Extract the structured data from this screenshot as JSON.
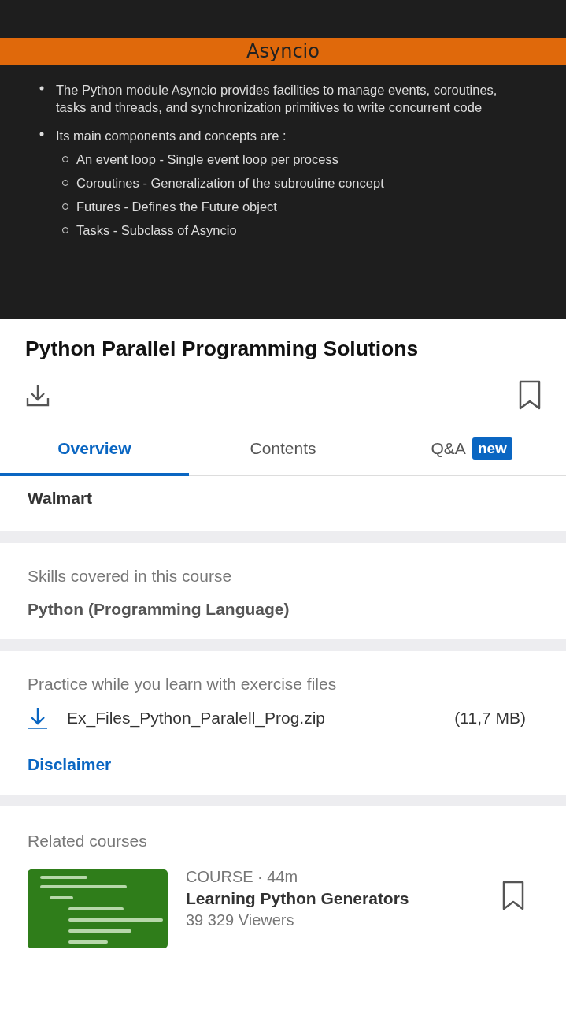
{
  "slide": {
    "title": "Asyncio",
    "bullets": [
      {
        "text": "The Python module Asyncio provides facilities to manage events, coroutines, tasks and threads, and synchronization primitives to write concurrent code"
      },
      {
        "text": "Its main components and concepts are :",
        "children": [
          "An event loop - Single event loop per process",
          "Coroutines - Generalization of the subroutine concept",
          "Futures - Defines the Future object",
          "Tasks - Subclass of Asyncio"
        ]
      }
    ]
  },
  "course": {
    "title": "Python Parallel Programming Solutions",
    "bookmarked": false
  },
  "tabs": [
    {
      "label": "Overview",
      "selected": true
    },
    {
      "label": "Contents",
      "selected": false
    },
    {
      "label": "Q&A",
      "selected": false,
      "badge": "new"
    }
  ],
  "company": "Walmart",
  "skills": {
    "heading": "Skills covered in this course",
    "value": "Python (Programming Language)"
  },
  "exercise": {
    "heading": "Practice while you learn with exercise files",
    "file": "Ex_Files_Python_Paralell_Prog.zip",
    "size": "(11,7 MB)",
    "link": "Disclaimer"
  },
  "related": {
    "heading": "Related courses",
    "items": [
      {
        "meta": "COURSE · 44m",
        "title": "Learning Python Generators",
        "viewers": "39 329 Viewers",
        "bookmarked": false
      }
    ]
  }
}
